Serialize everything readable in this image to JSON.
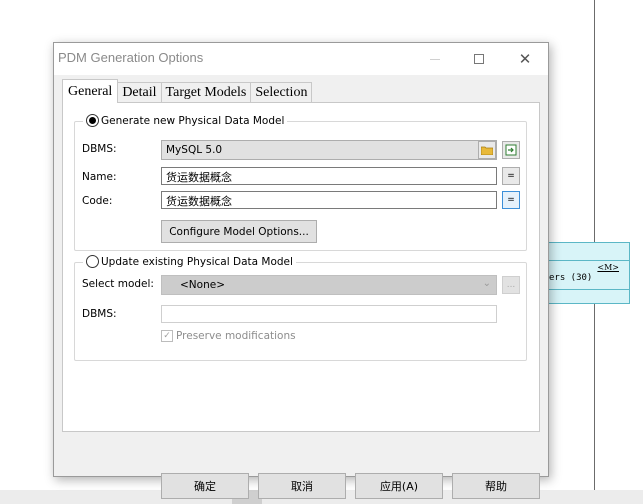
{
  "dialog": {
    "title": "PDM Generation Options",
    "tabs": [
      {
        "label": "General",
        "active": true
      },
      {
        "label": "Detail",
        "active": false
      },
      {
        "label": "Target Models",
        "active": false
      },
      {
        "label": "Selection",
        "active": false
      }
    ],
    "generate_group": {
      "radio_label": "Generate new Physical Data Model",
      "selected": true,
      "dbms_label": "DBMS:",
      "dbms_value": "MySQL 5.0",
      "name_label": "Name:",
      "name_value": "货运数据概念",
      "code_label": "Code:",
      "code_value": "货运数据概念",
      "equals_symbol": "=",
      "configure_button": "Configure Model Options..."
    },
    "update_group": {
      "radio_label": "Update existing Physical Data Model",
      "selected": false,
      "select_model_label": "Select model:",
      "select_model_value": "<None>",
      "ellipsis": "...",
      "dbms_label": "DBMS:",
      "dbms_value": "",
      "preserve_label": "Preserve modifications",
      "preserve_checked": true
    },
    "buttons": {
      "ok": "确定",
      "cancel": "取消",
      "apply": "应用(A)",
      "help": "帮助"
    }
  },
  "background": {
    "entity_tag": "<M>",
    "entity_attr_fragment": "ers (30)"
  },
  "colors": {
    "entity_fill": "#d8f4f8",
    "entity_border": "#5bb7c6",
    "dialog_face": "#f0f0f0",
    "focus_blue": "#3c8fd8"
  }
}
